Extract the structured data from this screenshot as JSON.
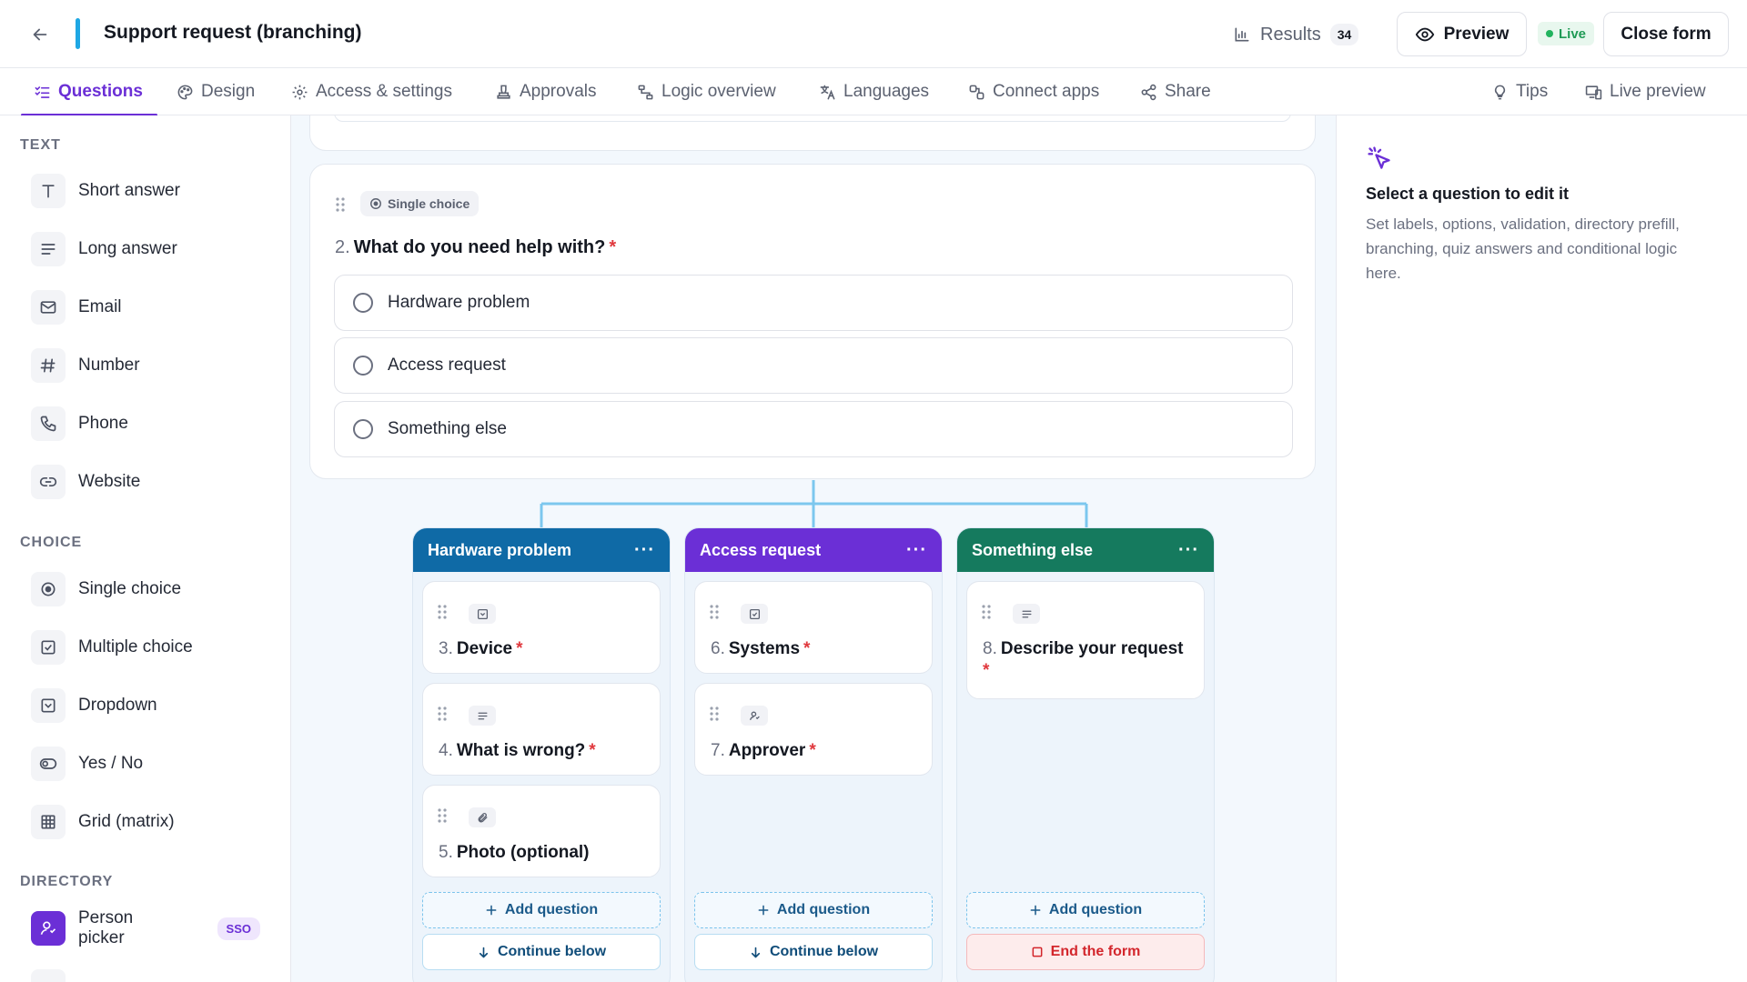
{
  "header": {
    "back_icon": "arrow-left-icon",
    "title": "Support request (branching)",
    "results_label": "Results",
    "results_count": "34",
    "preview_label": "Preview",
    "live_label": "Live",
    "close_label": "Close form",
    "accent_color": "#1ea7e4"
  },
  "tabs": [
    {
      "label": "Questions",
      "icon": "list-check-icon",
      "active": true
    },
    {
      "label": "Design",
      "icon": "palette-icon"
    },
    {
      "label": "Access & settings",
      "icon": "gear-icon"
    },
    {
      "label": "Approvals",
      "icon": "stamp-icon"
    },
    {
      "label": "Logic overview",
      "icon": "flow-icon"
    },
    {
      "label": "Languages",
      "icon": "translate-icon"
    },
    {
      "label": "Connect apps",
      "icon": "plug-icon"
    },
    {
      "label": "Share",
      "icon": "share-icon"
    },
    {
      "label": "Tips",
      "icon": "bulb-icon"
    },
    {
      "label": "Live preview",
      "icon": "devices-icon"
    }
  ],
  "sidebar": {
    "sections": [
      {
        "heading": "TEXT",
        "items": [
          {
            "label": "Short answer",
            "icon": "text-t-icon"
          },
          {
            "label": "Long answer",
            "icon": "paragraph-icon"
          },
          {
            "label": "Email",
            "icon": "mail-icon"
          },
          {
            "label": "Number",
            "icon": "hash-icon"
          },
          {
            "label": "Phone",
            "icon": "phone-icon"
          },
          {
            "label": "Website",
            "icon": "link-icon"
          }
        ]
      },
      {
        "heading": "CHOICE",
        "items": [
          {
            "label": "Single choice",
            "icon": "radio-icon"
          },
          {
            "label": "Multiple choice",
            "icon": "checkbox-icon"
          },
          {
            "label": "Dropdown",
            "icon": "dropdown-icon"
          },
          {
            "label": "Yes / No",
            "icon": "toggle-icon"
          },
          {
            "label": "Grid (matrix)",
            "icon": "grid-icon"
          }
        ]
      },
      {
        "heading": "DIRECTORY",
        "items": [
          {
            "label": "Person picker",
            "icon": "person-icon",
            "badge": "SSO"
          }
        ]
      }
    ]
  },
  "question": {
    "type_label": "Single choice",
    "number": "2.",
    "title": "What do you need help with?",
    "required_mark": "*",
    "options": [
      "Hardware problem",
      "Access request",
      "Something else"
    ]
  },
  "branches": [
    {
      "title": "Hardware problem",
      "color": "#0f6aa6",
      "menu": "···",
      "questions": [
        {
          "number": "3.",
          "title": "Device",
          "required": "*",
          "icon": "dropdown-icon"
        },
        {
          "number": "4.",
          "title": "What is wrong?",
          "required": "*",
          "icon": "paragraph-icon"
        },
        {
          "number": "5.",
          "title": "Photo (optional)",
          "required": "",
          "icon": "paperclip-icon"
        }
      ],
      "add_label": "Add question",
      "footer_label": "Continue below",
      "footer_type": "continue"
    },
    {
      "title": "Access request",
      "color": "#6b2fd6",
      "menu": "···",
      "questions": [
        {
          "number": "6.",
          "title": "Systems",
          "required": "*",
          "icon": "checkbox-icon"
        },
        {
          "number": "7.",
          "title": "Approver",
          "required": "*",
          "icon": "person-icon"
        }
      ],
      "add_label": "Add question",
      "footer_label": "Continue below",
      "footer_type": "continue"
    },
    {
      "title": "Something else",
      "color": "#157a5e",
      "menu": "···",
      "questions": [
        {
          "number": "8.",
          "title": "Describe your request",
          "required": "*",
          "icon": "paragraph-icon"
        }
      ],
      "add_label": "Add question",
      "footer_label": "End the form",
      "footer_type": "end"
    }
  ],
  "right_panel": {
    "icon": "pointer-click-icon",
    "title": "Select a question to edit it",
    "text": "Set labels, options, validation, directory prefill, branching, quiz answers and conditional logic here."
  }
}
